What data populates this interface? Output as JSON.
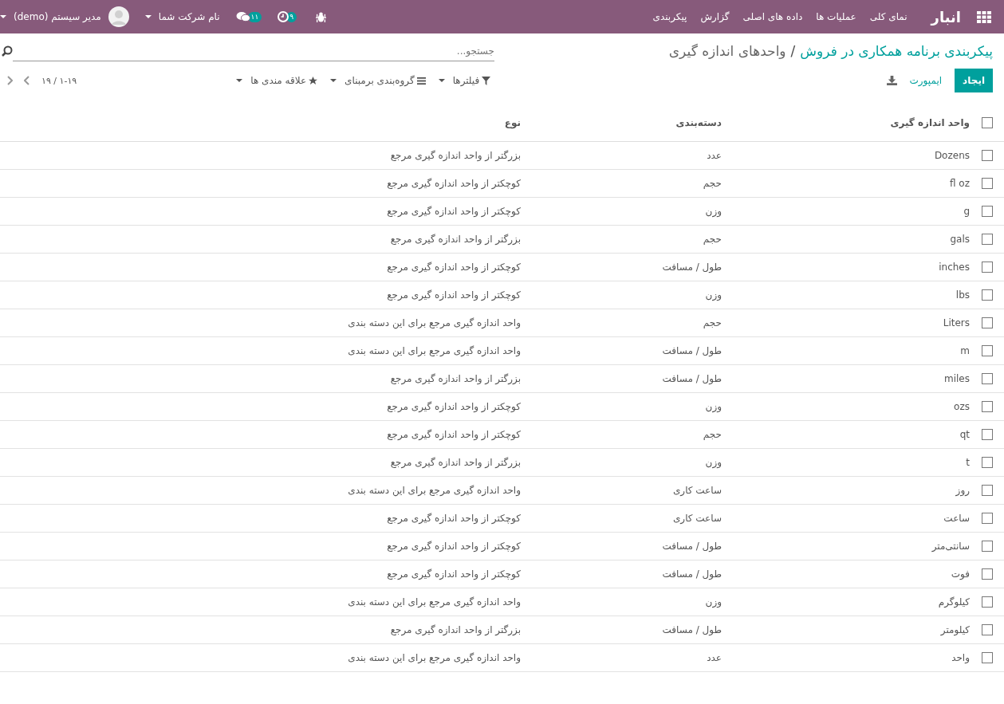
{
  "navbar": {
    "brand": "انبار",
    "menus": [
      "نمای کلی",
      "عملیات ها",
      "داده های اصلی",
      "گزارش",
      "پیکربندی"
    ],
    "activity_count": "۹",
    "message_count": "۱۱",
    "company": "نام شرکت شما",
    "user": "مدیر سیستم (demo)"
  },
  "breadcrumb": {
    "parent": "پیکربندی برنامه همکاری در فروش",
    "separator": "/",
    "current": "واحدهای اندازه گیری"
  },
  "search": {
    "placeholder": "جستجو..."
  },
  "buttons": {
    "create": "ایجاد",
    "import": "ایمپورت"
  },
  "filters": [
    "فیلترها",
    "گروه‌بندی برمبنای",
    "علاقه مندی ها"
  ],
  "pager": "۱-۱۹ / ۱۹",
  "table": {
    "select_all_checked": false,
    "columns": [
      "واحد اندازه گیری",
      "دسته‌بندی",
      "نوع"
    ],
    "rows": [
      {
        "checked": false,
        "name": "Dozens",
        "category": "عدد",
        "type": "بزرگتر از واحد اندازه گیری مرجع"
      },
      {
        "checked": false,
        "name": "fl oz",
        "category": "حجم",
        "type": "کوچکتر از واحد اندازه گیری مرجع"
      },
      {
        "checked": false,
        "name": "g",
        "category": "وزن",
        "type": "کوچکتر از واحد اندازه گیری مرجع"
      },
      {
        "checked": false,
        "name": "gals",
        "category": "حجم",
        "type": "بزرگتر از واحد اندازه گیری مرجع"
      },
      {
        "checked": false,
        "name": "inches",
        "category": "طول / مسافت",
        "type": "کوچکتر از واحد اندازه گیری مرجع"
      },
      {
        "checked": false,
        "name": "lbs",
        "category": "وزن",
        "type": "کوچکتر از واحد اندازه گیری مرجع"
      },
      {
        "checked": false,
        "name": "Liters",
        "category": "حجم",
        "type": "واحد اندازه گیری مرجع برای این دسته بندی"
      },
      {
        "checked": false,
        "name": "m",
        "category": "طول / مسافت",
        "type": "واحد اندازه گیری مرجع برای این دسته بندی"
      },
      {
        "checked": false,
        "name": "miles",
        "category": "طول / مسافت",
        "type": "بزرگتر از واحد اندازه گیری مرجع"
      },
      {
        "checked": false,
        "name": "ozs",
        "category": "وزن",
        "type": "کوچکتر از واحد اندازه گیری مرجع"
      },
      {
        "checked": false,
        "name": "qt",
        "category": "حجم",
        "type": "کوچکتر از واحد اندازه گیری مرجع"
      },
      {
        "checked": false,
        "name": "t",
        "category": "وزن",
        "type": "بزرگتر از واحد اندازه گیری مرجع"
      },
      {
        "checked": false,
        "name": "روز",
        "category": "ساعت کاری",
        "type": "واحد اندازه گیری مرجع برای این دسته بندی"
      },
      {
        "checked": false,
        "name": "ساعت",
        "category": "ساعت کاری",
        "type": "کوچکتر از واحد اندازه گیری مرجع"
      },
      {
        "checked": false,
        "name": "سانتی‌متر",
        "category": "طول / مسافت",
        "type": "کوچکتر از واحد اندازه گیری مرجع"
      },
      {
        "checked": false,
        "name": "فوت",
        "category": "طول / مسافت",
        "type": "کوچکتر از واحد اندازه گیری مرجع"
      },
      {
        "checked": false,
        "name": "کیلوگرم",
        "category": "وزن",
        "type": "واحد اندازه گیری مرجع برای این دسته بندی"
      },
      {
        "checked": false,
        "name": "کیلومتر",
        "category": "طول / مسافت",
        "type": "بزرگتر از واحد اندازه گیری مرجع"
      },
      {
        "checked": false,
        "name": "واحد",
        "category": "عدد",
        "type": "واحد اندازه گیری مرجع برای این دسته بندی"
      }
    ]
  }
}
